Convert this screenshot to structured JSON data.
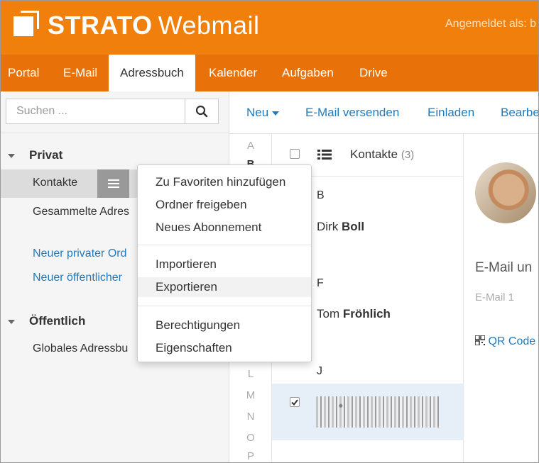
{
  "header": {
    "brand_bold": "STRATO",
    "brand_light": "Webmail",
    "logged_in": "Angemeldet als: b"
  },
  "nav": {
    "items": [
      "Portal",
      "E-Mail",
      "Adressbuch",
      "Kalender",
      "Aufgaben",
      "Drive"
    ],
    "active": "Adressbuch"
  },
  "sidebar": {
    "search_placeholder": "Suchen ...",
    "private_title": "Privat",
    "items": {
      "contacts": "Kontakte",
      "collected": "Gesammelte Adres"
    },
    "links": {
      "new_private": "Neuer privater Ord",
      "new_public": "Neuer öffentlicher"
    },
    "public_title": "Öffentlich",
    "global": "Globales Adressbu"
  },
  "toolbar": {
    "new": "Neu",
    "send_email": "E-Mail versenden",
    "invite": "Einladen",
    "edit": "Bearbe"
  },
  "alphabet": [
    "A",
    "B",
    "L",
    "M",
    "N",
    "O",
    "P"
  ],
  "list": {
    "title": "Kontakte",
    "count": "(3)",
    "groups": [
      {
        "letter": "B",
        "first": "Dirk",
        "last": "Boll"
      },
      {
        "letter": "F",
        "first": "Tom",
        "last": "Fröhlich"
      },
      {
        "letter": "J"
      }
    ]
  },
  "detail": {
    "heading": "E-Mail un",
    "sub": "E-Mail 1",
    "qr": "QR Code"
  },
  "context_menu": {
    "items": [
      "Zu Favoriten hinzufügen",
      "Ordner freigeben",
      "Neues Abonnement",
      "Importieren",
      "Exportieren",
      "Berechtigungen",
      "Eigenschaften"
    ],
    "hovered": "Exportieren"
  },
  "colors": {
    "header": "#f07f0b",
    "nav": "#e8710a",
    "link": "#1f7bbf"
  }
}
